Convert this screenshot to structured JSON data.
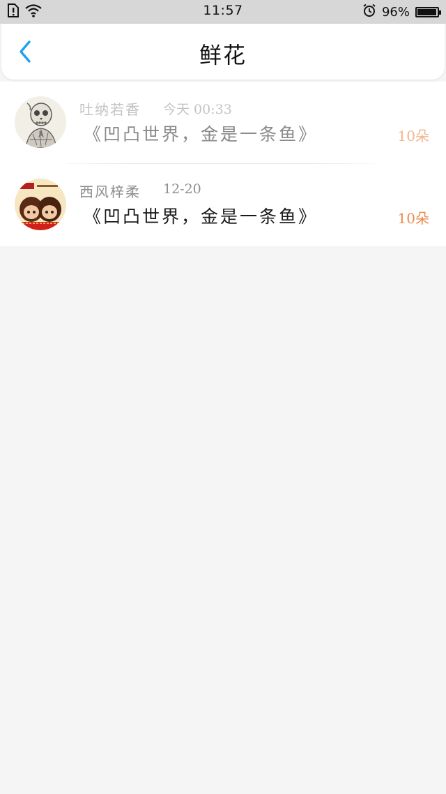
{
  "status_bar": {
    "time": "11:57",
    "battery": "96%",
    "battery_level": 0.96,
    "icons": [
      "sim-alert-icon",
      "wifi-icon",
      "alarm-icon",
      "battery-icon"
    ]
  },
  "header": {
    "title": "鲜花",
    "back_icon": "chevron-left-icon",
    "accent_color": "#1da1f2"
  },
  "gifts": [
    {
      "user": "吐纳若香",
      "time": "今天 00:33",
      "book": "《凹凸世界，金是一条鱼》",
      "count": "10朵",
      "avatar": "skull-sketch-avatar"
    },
    {
      "user": "西风梓柔",
      "time": "12-20",
      "book": "《凹凸世界，金是一条鱼》",
      "count": "10朵",
      "avatar": "cartoon-couple-avatar"
    }
  ],
  "colors": {
    "page_background": "#f5f5f5",
    "count_color": "#e98a4a"
  }
}
